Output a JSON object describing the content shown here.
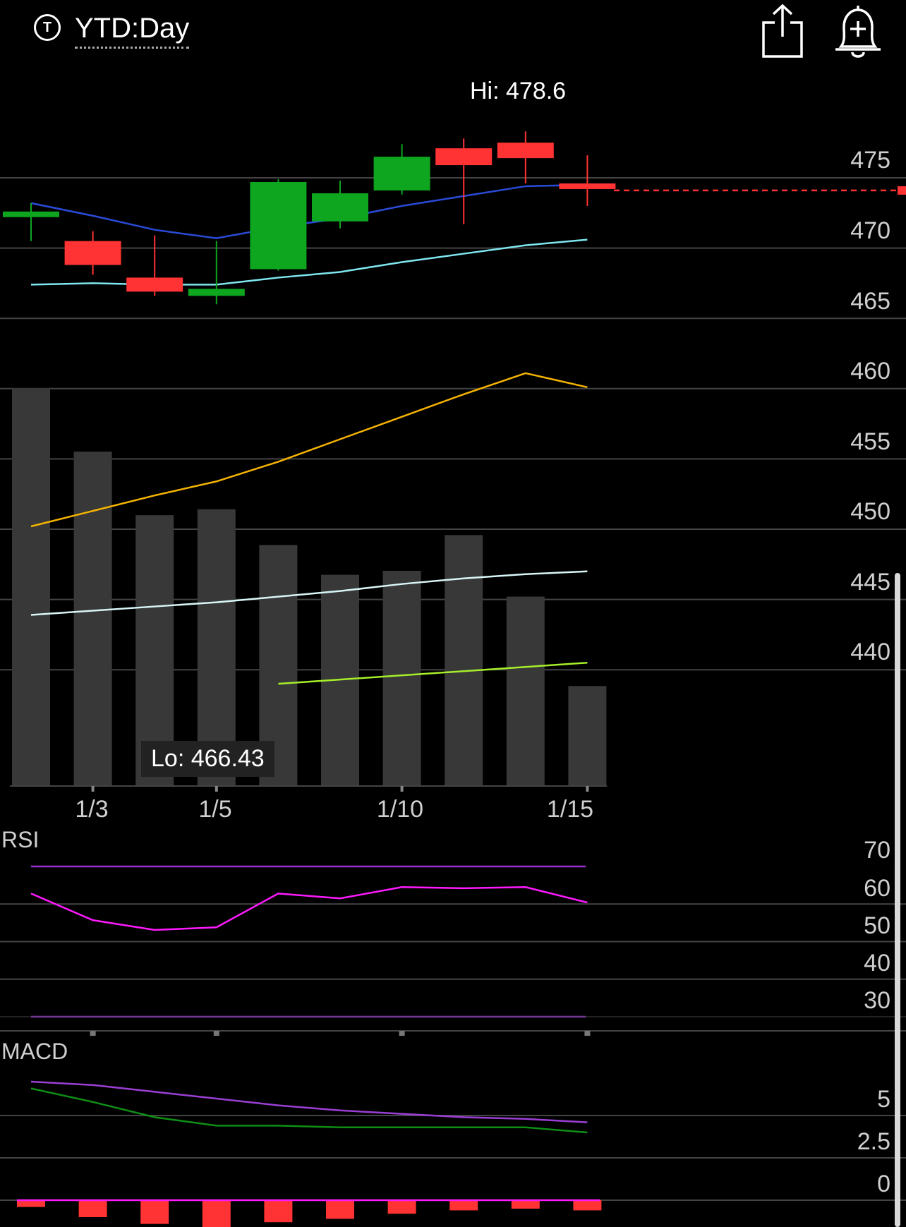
{
  "header": {
    "timeframe_icon": "circle-t-icon",
    "timeframe_icon_letter": "T",
    "timeframe_label": "YTD:Day",
    "share_icon": "share-icon",
    "alert_icon": "bell-plus-icon"
  },
  "colors": {
    "background": "#000000",
    "up_candle": "#0ea51f",
    "down_candle": "#ff3333",
    "volume_bar": "#383838",
    "gridline": "#444444",
    "ma_fast": "#2a4bd8",
    "ma_slow": "#7fe7ef",
    "ma_yellow": "#f5b300",
    "ma_white": "#d8f5f7",
    "ma_lime": "#a6ee2a",
    "rsi_line": "#ff1aff",
    "rsi_bounds": "#9b2fd4",
    "macd_line": "#9b3fd4",
    "signal_line": "#0f8e16",
    "histogram": "#ff3333",
    "zero_line": "#ff1aff",
    "last_price_line": "#ff3333"
  },
  "price_panel": {
    "hi_label": "Hi: 478.6",
    "lo_label": "Lo: 466.43",
    "y_ticks": [
      "475",
      "470",
      "465",
      "460",
      "455",
      "450",
      "445",
      "440"
    ],
    "x_ticks": [
      "1/3",
      "1/5",
      "1/10",
      "1/15"
    ]
  },
  "rsi_panel": {
    "title": "RSI",
    "y_ticks": [
      "70",
      "60",
      "50",
      "40",
      "30"
    ]
  },
  "macd_panel": {
    "title": "MACD",
    "y_ticks": [
      "5",
      "2.5",
      "0"
    ]
  },
  "chart_data": [
    {
      "type": "candlestick",
      "ylim": [
        435,
        480
      ],
      "y_ticks": [
        475,
        470,
        465,
        460,
        455,
        450,
        445,
        440
      ],
      "x_ticks": [
        "1/3",
        "1/5",
        "1/10",
        "1/15"
      ],
      "hi": 478.6,
      "lo": 466.43,
      "last_price": 474.1,
      "candles": [
        {
          "open": 472.2,
          "close": 472.6,
          "high": 473.2,
          "low": 470.5
        },
        {
          "open": 470.5,
          "close": 468.8,
          "high": 471.2,
          "low": 468.1
        },
        {
          "open": 467.9,
          "close": 466.9,
          "high": 470.9,
          "low": 466.6
        },
        {
          "open": 466.6,
          "close": 467.1,
          "high": 470.5,
          "low": 466.0
        },
        {
          "open": 468.5,
          "close": 474.7,
          "high": 474.9,
          "low": 468.4
        },
        {
          "open": 471.9,
          "close": 473.9,
          "high": 474.8,
          "low": 471.4
        },
        {
          "open": 474.1,
          "close": 476.5,
          "high": 477.4,
          "low": 473.8
        },
        {
          "open": 477.1,
          "close": 475.9,
          "high": 477.8,
          "low": 471.7
        },
        {
          "open": 477.5,
          "close": 476.4,
          "high": 478.3,
          "low": 474.6
        },
        {
          "open": 474.6,
          "close": 474.2,
          "high": 476.6,
          "low": 473.0
        }
      ],
      "series": [
        {
          "values": [
            473.2,
            472.3,
            471.3,
            470.7,
            471.5,
            472.1,
            473.0,
            473.7,
            474.4,
            474.5
          ]
        },
        {
          "values": [
            467.4,
            467.5,
            467.4,
            467.4,
            467.9,
            468.3,
            469.0,
            469.6,
            470.2,
            470.6
          ]
        },
        {
          "values": [
            450.2,
            451.3,
            452.4,
            453.4,
            454.8,
            456.4,
            458.0,
            459.6,
            461.1,
            460.1
          ]
        },
        {
          "values": [
            443.9,
            444.2,
            444.5,
            444.8,
            445.2,
            445.6,
            446.1,
            446.5,
            446.8,
            447.0
          ]
        },
        {
          "values": [
            null,
            null,
            null,
            null,
            439.0,
            439.3,
            439.6,
            439.9,
            440.2,
            440.5
          ]
        }
      ],
      "volume": [
        100,
        84,
        68,
        69.5,
        60.5,
        53,
        54,
        63,
        47.5,
        25
      ]
    },
    {
      "type": "line",
      "title": "RSI",
      "ylim": [
        28,
        72
      ],
      "y_ticks": [
        70,
        60,
        50,
        40,
        30
      ],
      "values": [
        62.8,
        55.7,
        53.1,
        53.8,
        62.8,
        61.5,
        64.5,
        64.2,
        64.5,
        60.4
      ],
      "overbought": 70,
      "oversold": 30
    },
    {
      "type": "line",
      "title": "MACD",
      "ylim": [
        -1.3,
        7.5
      ],
      "y_ticks": [
        5,
        2.5,
        0
      ],
      "series": [
        {
          "values": [
            7.0,
            6.8,
            6.4,
            6.0,
            5.6,
            5.3,
            5.1,
            4.9,
            4.8,
            4.6
          ]
        },
        {
          "values": [
            6.6,
            5.8,
            4.9,
            4.4,
            4.4,
            4.3,
            4.3,
            4.3,
            4.3,
            4.0
          ]
        }
      ],
      "histogram": [
        -0.4,
        -1.0,
        -1.4,
        -1.6,
        -1.3,
        -1.1,
        -0.8,
        -0.6,
        -0.5,
        -0.6
      ]
    }
  ]
}
